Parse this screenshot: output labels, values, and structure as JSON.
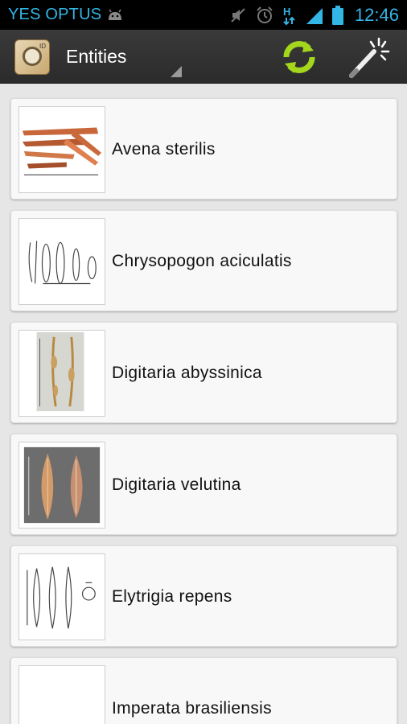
{
  "status_bar": {
    "carrier": "YES OPTUS",
    "clock": "12:46",
    "icons": [
      "android-icon",
      "mute-icon",
      "alarm-icon",
      "hspa-icon",
      "signal-icon",
      "battery-icon"
    ]
  },
  "action_bar": {
    "title": "Entities",
    "app_icon": "magnifier-app-icon",
    "app_icon_badge": "ID",
    "actions": [
      "refresh-icon",
      "magic-wand-icon"
    ],
    "refresh_color": "#a4d61c"
  },
  "entities": [
    {
      "name": "Avena sterilis",
      "thumb": "photo"
    },
    {
      "name": "Chrysopogon aciculatis",
      "thumb": "illustration"
    },
    {
      "name": "Digitaria abyssinica",
      "thumb": "photo"
    },
    {
      "name": "Digitaria velutina",
      "thumb": "photo"
    },
    {
      "name": "Elytrigia repens",
      "thumb": "illustration"
    },
    {
      "name": "Imperata brasiliensis",
      "thumb": "blank"
    }
  ]
}
